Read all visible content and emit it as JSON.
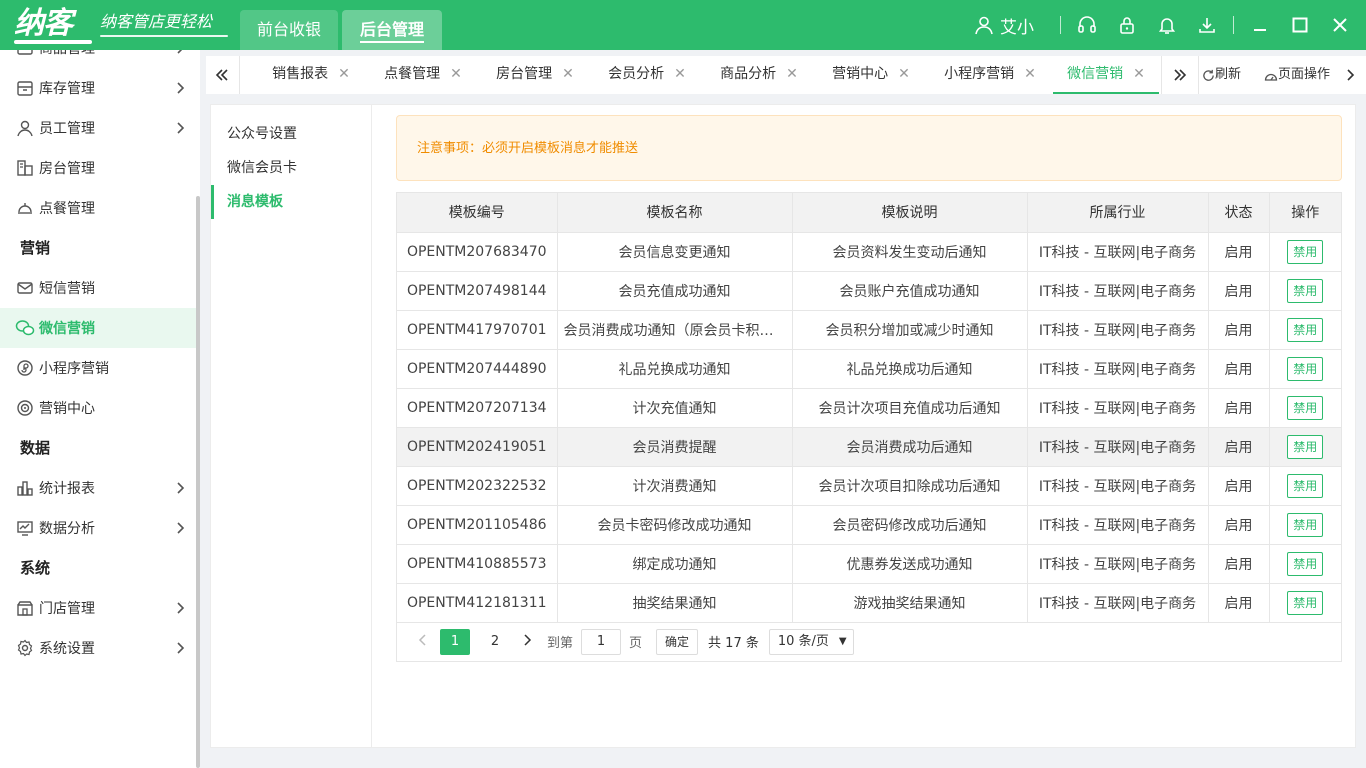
{
  "brand": {
    "logo": "纳客",
    "slogan": "纳客管店更轻松"
  },
  "topnav": {
    "front": "前台收银",
    "back": "后台管理"
  },
  "header": {
    "user": "艾小"
  },
  "sidebar": {
    "items": [
      {
        "label": "商品管理",
        "icon": "box-icon",
        "chevron": true
      },
      {
        "label": "库存管理",
        "icon": "inventory-icon",
        "chevron": true
      },
      {
        "label": "员工管理",
        "icon": "user-icon",
        "chevron": true
      },
      {
        "label": "房台管理",
        "icon": "room-icon",
        "chevron": false
      },
      {
        "label": "点餐管理",
        "icon": "dish-icon",
        "chevron": false
      }
    ],
    "groups": {
      "marketing": "营销",
      "data": "数据",
      "system": "系统"
    },
    "marketing_items": [
      {
        "label": "短信营销",
        "icon": "mail-icon"
      },
      {
        "label": "微信营销",
        "icon": "wechat-icon"
      },
      {
        "label": "小程序营销",
        "icon": "miniprogram-icon"
      },
      {
        "label": "营销中心",
        "icon": "target-icon"
      }
    ],
    "data_items": [
      {
        "label": "统计报表",
        "icon": "bar-chart-icon"
      },
      {
        "label": "数据分析",
        "icon": "trend-icon"
      }
    ],
    "system_items": [
      {
        "label": "门店管理",
        "icon": "store-icon"
      },
      {
        "label": "系统设置",
        "icon": "settings-icon"
      }
    ]
  },
  "tabs": [
    "销售报表",
    "点餐管理",
    "房台管理",
    "会员分析",
    "商品分析",
    "营销中心",
    "小程序营销",
    "微信营销"
  ],
  "tab_actions": {
    "refresh": "刷新",
    "page_ops": "页面操作"
  },
  "subnav": [
    "公众号设置",
    "微信会员卡",
    "消息模板"
  ],
  "notice": "注意事项：必须开启模板消息才能推送",
  "table": {
    "headers": [
      "模板编号",
      "模板名称",
      "模板说明",
      "所属行业",
      "状态",
      "操作"
    ],
    "rows": [
      [
        "OPENTM207683470",
        "会员信息变更通知",
        "会员资料发生变动后通知",
        "IT科技 - 互联网|电子商务",
        "启用",
        "禁用"
      ],
      [
        "OPENTM207498144",
        "会员充值成功通知",
        "会员账户充值成功通知",
        "IT科技 - 互联网|电子商务",
        "启用",
        "禁用"
      ],
      [
        "OPENTM417970701",
        "会员消费成功通知（原会员卡积分...",
        "会员积分增加或减少时通知",
        "IT科技 - 互联网|电子商务",
        "启用",
        "禁用"
      ],
      [
        "OPENTM207444890",
        "礼品兑换成功通知",
        "礼品兑换成功后通知",
        "IT科技 - 互联网|电子商务",
        "启用",
        "禁用"
      ],
      [
        "OPENTM207207134",
        "计次充值通知",
        "会员计次项目充值成功后通知",
        "IT科技 - 互联网|电子商务",
        "启用",
        "禁用"
      ],
      [
        "OPENTM202419051",
        "会员消费提醒",
        "会员消费成功后通知",
        "IT科技 - 互联网|电子商务",
        "启用",
        "禁用"
      ],
      [
        "OPENTM202322532",
        "计次消费通知",
        "会员计次项目扣除成功后通知",
        "IT科技 - 互联网|电子商务",
        "启用",
        "禁用"
      ],
      [
        "OPENTM201105486",
        "会员卡密码修改成功通知",
        "会员密码修改成功后通知",
        "IT科技 - 互联网|电子商务",
        "启用",
        "禁用"
      ],
      [
        "OPENTM410885573",
        "绑定成功通知",
        "优惠券发送成功通知",
        "IT科技 - 互联网|电子商务",
        "启用",
        "禁用"
      ],
      [
        "OPENTM412181311",
        "抽奖结果通知",
        "游戏抽奖结果通知",
        "IT科技 - 互联网|电子商务",
        "启用",
        "禁用"
      ]
    ]
  },
  "pagination": {
    "pages": [
      "1",
      "2"
    ],
    "current": "1",
    "goto_label": "到第",
    "goto_value": "1",
    "page_unit": "页",
    "confirm": "确定",
    "total": "共 17 条",
    "page_size": "10 条/页"
  },
  "colors": {
    "primary": "#2dbb6d",
    "notice_text": "#f08c00",
    "notice_bg": "#fff7ea"
  }
}
